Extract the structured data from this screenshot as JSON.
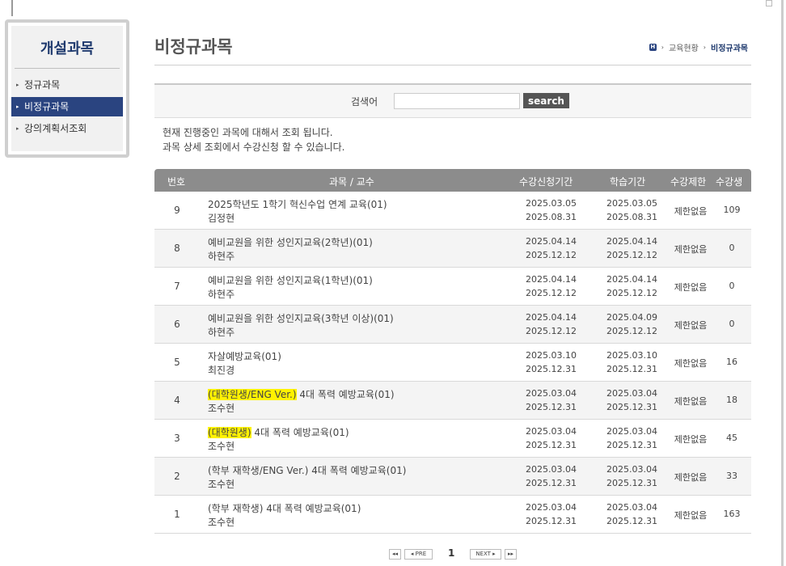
{
  "sidebar": {
    "title": "개설과목",
    "items": [
      {
        "label": "정규과목",
        "active": false
      },
      {
        "label": "비정규과목",
        "active": true
      },
      {
        "label": "강의계획서조회",
        "active": false
      }
    ]
  },
  "header": {
    "title": "비정규과목",
    "breadcrumb": {
      "home_icon": "H",
      "parent": "교육현황",
      "current": "비정규과목"
    }
  },
  "search": {
    "label": "검색어",
    "value": "",
    "button": "search"
  },
  "notice": {
    "line1": "현재 진행중인 과목에 대해서 조회 됩니다.",
    "line2": "과목 상세 조회에서 수강신청 할 수 있습니다."
  },
  "table": {
    "headers": {
      "no": "번호",
      "course": "과목 / 교수",
      "apply": "수강신청기간",
      "study": "학습기간",
      "limit": "수강제한",
      "count": "수강생"
    },
    "rows": [
      {
        "no": "9",
        "hl": "",
        "title": "2025학년도 1학기 혁신수업 연계 교육(01)",
        "prof": "김정현",
        "apply_start": "2025.03.05",
        "apply_end": "2025.08.31",
        "study_start": "2025.03.05",
        "study_end": "2025.08.31",
        "limit": "제한없음",
        "count": "109"
      },
      {
        "no": "8",
        "hl": "",
        "title": "예비교원을 위한 성인지교육(2학년)(01)",
        "prof": "하현주",
        "apply_start": "2025.04.14",
        "apply_end": "2025.12.12",
        "study_start": "2025.04.14",
        "study_end": "2025.12.12",
        "limit": "제한없음",
        "count": "0"
      },
      {
        "no": "7",
        "hl": "",
        "title": "예비교원을 위한 성인지교육(1학년)(01)",
        "prof": "하현주",
        "apply_start": "2025.04.14",
        "apply_end": "2025.12.12",
        "study_start": "2025.04.14",
        "study_end": "2025.12.12",
        "limit": "제한없음",
        "count": "0"
      },
      {
        "no": "6",
        "hl": "",
        "title": "예비교원을 위한 성인지교육(3학년 이상)(01)",
        "prof": "하현주",
        "apply_start": "2025.04.14",
        "apply_end": "2025.12.12",
        "study_start": "2025.04.09",
        "study_end": "2025.12.12",
        "limit": "제한없음",
        "count": "0"
      },
      {
        "no": "5",
        "hl": "",
        "title": "자살예방교육(01)",
        "prof": "최진경",
        "apply_start": "2025.03.10",
        "apply_end": "2025.12.31",
        "study_start": "2025.03.10",
        "study_end": "2025.12.31",
        "limit": "제한없음",
        "count": "16"
      },
      {
        "no": "4",
        "hl": "(대학원생/ENG Ver.)",
        "title": " 4대 폭력 예방교육(01)",
        "prof": "조수현",
        "apply_start": "2025.03.04",
        "apply_end": "2025.12.31",
        "study_start": "2025.03.04",
        "study_end": "2025.12.31",
        "limit": "제한없음",
        "count": "18"
      },
      {
        "no": "3",
        "hl": "(대학원생)",
        "title": " 4대 폭력 예방교육(01)",
        "prof": "조수현",
        "apply_start": "2025.03.04",
        "apply_end": "2025.12.31",
        "study_start": "2025.03.04",
        "study_end": "2025.12.31",
        "limit": "제한없음",
        "count": "45"
      },
      {
        "no": "2",
        "hl": "",
        "title": "(학부 재학생/ENG Ver.) 4대 폭력 예방교육(01)",
        "prof": "조수현",
        "apply_start": "2025.03.04",
        "apply_end": "2025.12.31",
        "study_start": "2025.03.04",
        "study_end": "2025.12.31",
        "limit": "제한없음",
        "count": "33"
      },
      {
        "no": "1",
        "hl": "",
        "title": "(학부 재학생) 4대 폭력 예방교육(01)",
        "prof": "조수현",
        "apply_start": "2025.03.04",
        "apply_end": "2025.12.31",
        "study_start": "2025.03.04",
        "study_end": "2025.12.31",
        "limit": "제한없음",
        "count": "163"
      }
    ]
  },
  "pager": {
    "first": "◂◂",
    "prev": "◂ PRE",
    "current": "1",
    "next": "NEXT ▸",
    "last": "▸▸"
  },
  "colors": {
    "accent": "#2a4480",
    "header_gray": "#8c8c8c",
    "highlight": "#fff200"
  }
}
